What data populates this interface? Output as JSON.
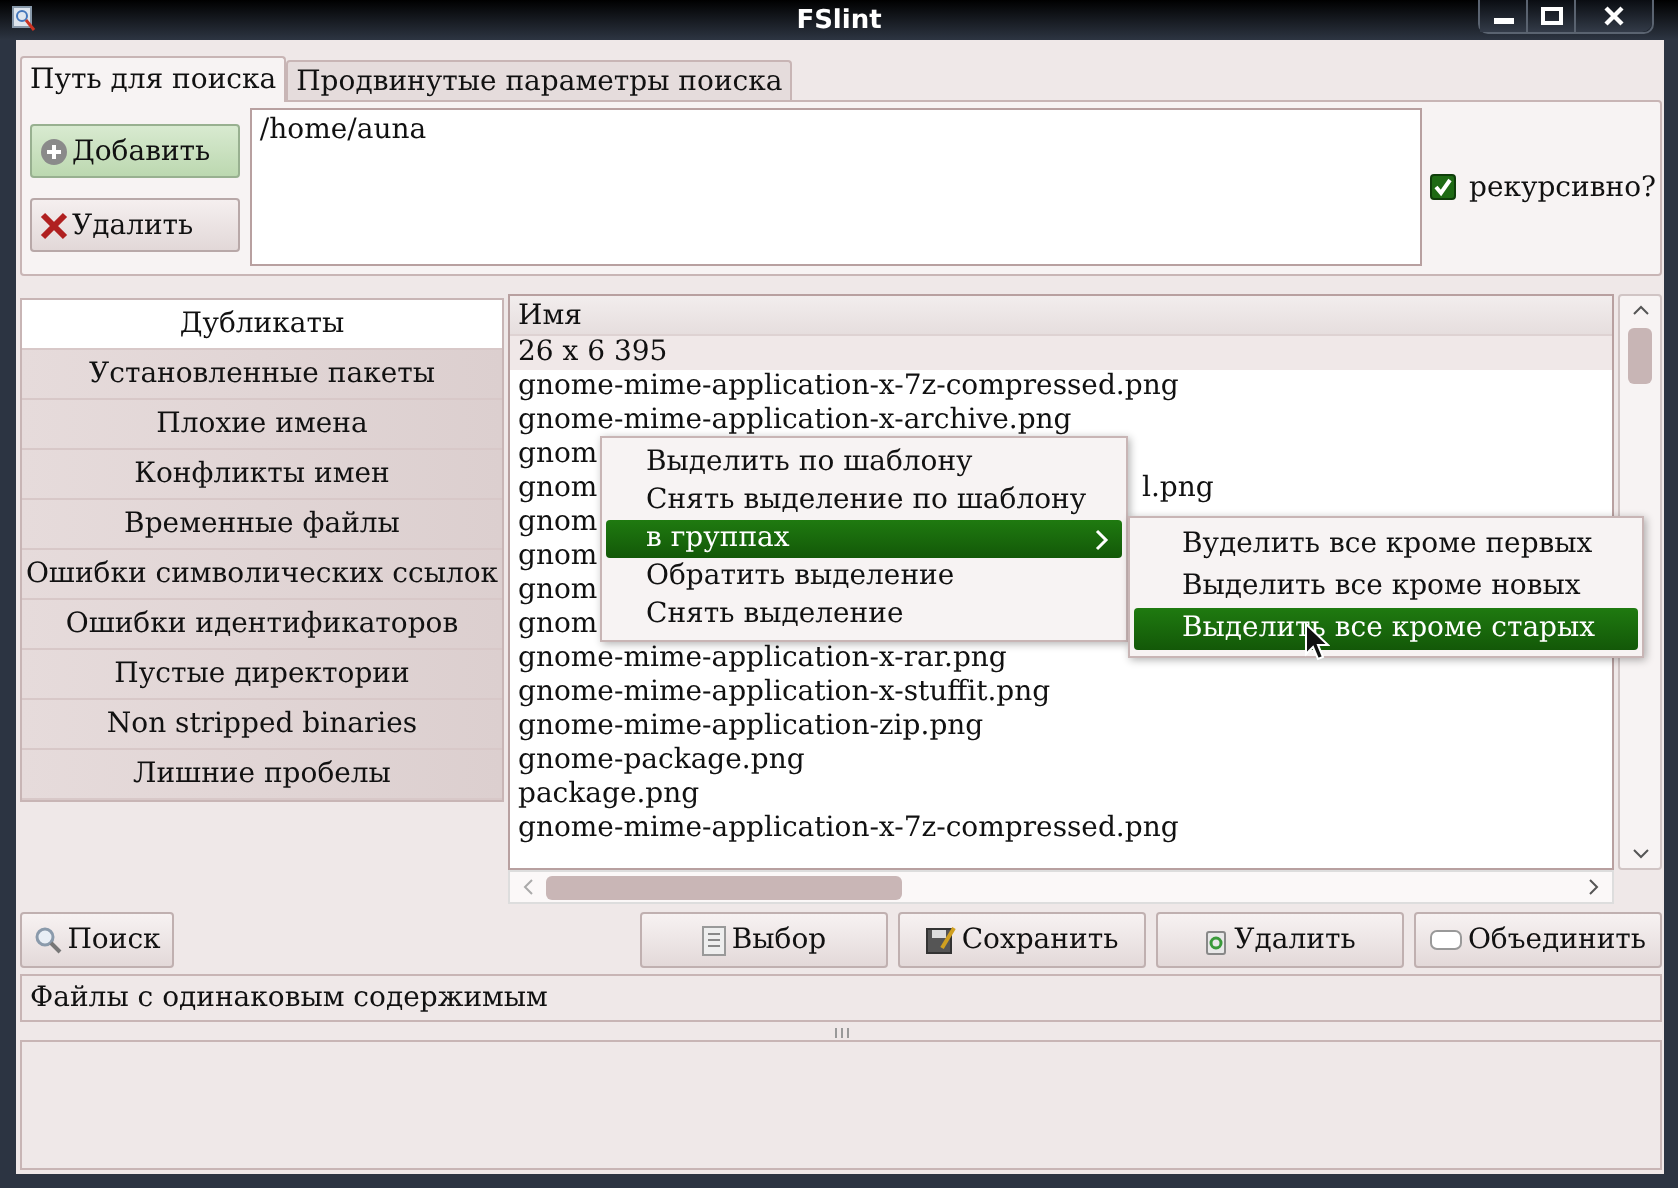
{
  "window": {
    "title": "FSlint"
  },
  "tabs": [
    {
      "label": "Путь для поиска",
      "selected": true
    },
    {
      "label": "Продвинутые параметры поиска",
      "selected": false
    }
  ],
  "path_buttons": [
    {
      "label": "Добавить",
      "kind": "add"
    },
    {
      "label": "Удалить",
      "kind": "remove"
    }
  ],
  "paths": [
    "/home/auna"
  ],
  "recursive": {
    "label": "рекурсивно?",
    "checked": true
  },
  "sidebar": {
    "items": [
      {
        "label": "Дубликаты",
        "selected": true
      },
      {
        "label": "Установленные пакеты",
        "selected": false
      },
      {
        "label": "Плохие имена",
        "selected": false
      },
      {
        "label": "Конфликты имен",
        "selected": false
      },
      {
        "label": "Временные файлы",
        "selected": false
      },
      {
        "label": "Ошибки символических ссылок",
        "selected": false
      },
      {
        "label": "Ошибки идентификаторов",
        "selected": false
      },
      {
        "label": "Пустые директории",
        "selected": false
      },
      {
        "label": "Non stripped binaries",
        "selected": false
      },
      {
        "label": "Лишние пробелы",
        "selected": false
      }
    ]
  },
  "file_list": {
    "columns": [
      "Имя"
    ],
    "rows": [
      {
        "text": "26 x 6 395"
      },
      {
        "text": "gnome-mime-application-x-7z-compressed.png"
      },
      {
        "text": "gnome-mime-application-x-archive.png"
      },
      {
        "text": "gnom"
      },
      {
        "text": "gnom",
        "tail": "l.png"
      },
      {
        "text": "gnom"
      },
      {
        "text": "gnom"
      },
      {
        "text": "gnom"
      },
      {
        "text": "gnom"
      },
      {
        "text": "gnome-mime-application-x-rar.png"
      },
      {
        "text": "gnome-mime-application-x-stuffit.png"
      },
      {
        "text": "gnome-mime-application-zip.png"
      },
      {
        "text": "gnome-package.png"
      },
      {
        "text": "package.png"
      },
      {
        "text": "gnome-mime-application-x-7z-compressed.png"
      }
    ]
  },
  "context_menu": {
    "items": [
      {
        "label": "Выделить по шаблону",
        "selected": false,
        "submenu": false
      },
      {
        "label": "Снять выделение по шаблону",
        "selected": false,
        "submenu": false
      },
      {
        "label": "в группах",
        "selected": true,
        "submenu": true
      },
      {
        "label": "Обратить выделение",
        "selected": false,
        "submenu": false
      },
      {
        "label": "Снять выделение",
        "selected": false,
        "submenu": false
      }
    ]
  },
  "submenu": {
    "items": [
      {
        "label": "Вуделить все кроме первых",
        "selected": false
      },
      {
        "label": "Выделить все кроме новых",
        "selected": false
      },
      {
        "label": "Выделить все кроме старых",
        "selected": true
      }
    ]
  },
  "search_button": {
    "label": "Поиск"
  },
  "actions": [
    {
      "label": "Выбор",
      "kind": "select"
    },
    {
      "label": "Сохранить",
      "kind": "save"
    },
    {
      "label": "Удалить",
      "kind": "delete"
    },
    {
      "label": "Объединить",
      "kind": "merge"
    }
  ],
  "status_bar": {
    "text": "Файлы с одинаковым содержимым"
  }
}
